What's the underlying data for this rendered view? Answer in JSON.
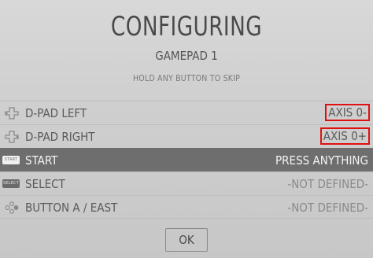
{
  "header": {
    "title": "CONFIGURING",
    "device": "GAMEPAD 1",
    "hint": "HOLD ANY BUTTON TO SKIP"
  },
  "mappings": [
    {
      "label": "D-PAD LEFT",
      "value": "AXIS 0-",
      "icon": "dpad-icon",
      "highlighted": true
    },
    {
      "label": "D-PAD RIGHT",
      "value": "AXIS 0+",
      "icon": "dpad-icon",
      "highlighted": true
    },
    {
      "label": "START",
      "value": "PRESS ANYTHING",
      "icon": "start-button-icon",
      "icon_text": "START",
      "selected": true
    },
    {
      "label": "SELECT",
      "value": "-NOT DEFINED-",
      "icon": "select-button-icon",
      "icon_text": "SELECT"
    },
    {
      "label": "BUTTON A / EAST",
      "value": "-NOT DEFINED-",
      "icon": "face-buttons-icon"
    }
  ],
  "ok_label": "OK",
  "colors": {
    "background": "#cfcfcf",
    "selected_row": "#6e6e6e",
    "highlight_box": "#e01010"
  }
}
